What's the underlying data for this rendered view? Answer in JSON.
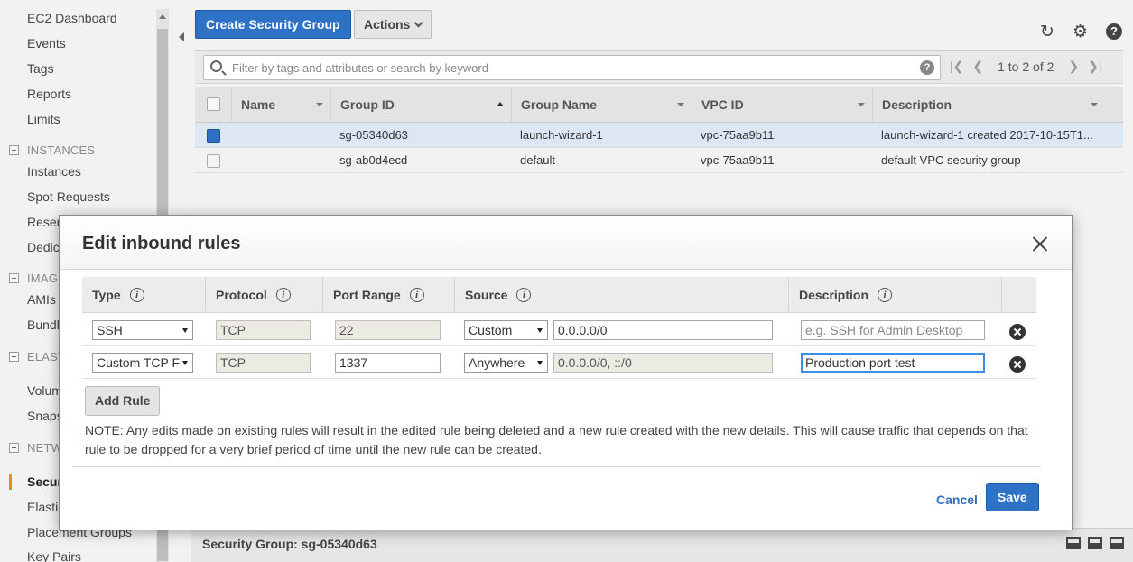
{
  "sidebar": {
    "items": [
      {
        "label": "EC2 Dashboard"
      },
      {
        "label": "Events"
      },
      {
        "label": "Tags"
      },
      {
        "label": "Reports"
      },
      {
        "label": "Limits"
      },
      {
        "label": "Instances"
      },
      {
        "label": "Spot Requests"
      },
      {
        "label": "Reserved Instances"
      },
      {
        "label": "Dedicated Hosts"
      },
      {
        "label": "AMIs"
      },
      {
        "label": "Bundle Tasks"
      },
      {
        "label": "Volumes"
      },
      {
        "label": "Snapshots"
      },
      {
        "label": "Security Groups"
      },
      {
        "label": "Elastic IPs"
      },
      {
        "label": "Placement Groups"
      },
      {
        "label": "Key Pairs"
      }
    ],
    "sections": [
      {
        "label": "INSTANCES"
      },
      {
        "label": "IMAGES"
      },
      {
        "label": "ELASTIC BLOCK STORE"
      },
      {
        "label": "NETWORK & SECURITY"
      }
    ],
    "active_item": "Security Groups"
  },
  "toolbar": {
    "create_label": "Create Security Group",
    "actions_label": "Actions"
  },
  "filter": {
    "placeholder": "Filter by tags and attributes or search by keyword",
    "help": "?",
    "pager_text": "1 to 2 of 2"
  },
  "table": {
    "columns": [
      "Name",
      "Group ID",
      "Group Name",
      "VPC ID",
      "Description"
    ],
    "sort_column": "Group ID",
    "rows": [
      {
        "name": "",
        "group_id": "sg-05340d63",
        "group_name": "launch-wizard-1",
        "vpc_id": "vpc-75aa9b11",
        "description": "launch-wizard-1 created 2017-10-15T1...",
        "selected": true
      },
      {
        "name": "",
        "group_id": "sg-ab0d4ecd",
        "group_name": "default",
        "vpc_id": "vpc-75aa9b11",
        "description": "default VPC security group",
        "selected": false
      }
    ]
  },
  "details": {
    "label": "Security Group: sg-05340d63"
  },
  "modal": {
    "title": "Edit inbound rules",
    "columns": [
      "Type",
      "Protocol",
      "Port Range",
      "Source",
      "Description"
    ],
    "rules": [
      {
        "type": "SSH",
        "protocol": "TCP",
        "port_range": "22",
        "source_mode": "Custom",
        "source_value": "0.0.0.0/0",
        "description": "",
        "description_placeholder": "e.g. SSH for Admin Desktop"
      },
      {
        "type": "Custom TCP F",
        "protocol": "TCP",
        "port_range": "1337",
        "source_mode": "Anywhere",
        "source_value": "0.0.0.0/0, ::/0",
        "description": "Production port test",
        "description_placeholder": ""
      }
    ],
    "add_rule_label": "Add Rule",
    "note": "NOTE: Any edits made on existing rules will result in the edited rule being deleted and a new rule created with the new details. This will cause traffic that depends on that rule to be dropped for a very brief period of time until the new rule can be created.",
    "cancel_label": "Cancel",
    "save_label": "Save"
  },
  "colors": {
    "primary": "#2d72c4",
    "active_marker": "#e88b1f",
    "focus_border": "#3d8ee6"
  },
  "icons": [
    "refresh-icon",
    "gear-icon",
    "help-icon",
    "search-icon",
    "close-icon",
    "remove-rule-icon"
  ]
}
